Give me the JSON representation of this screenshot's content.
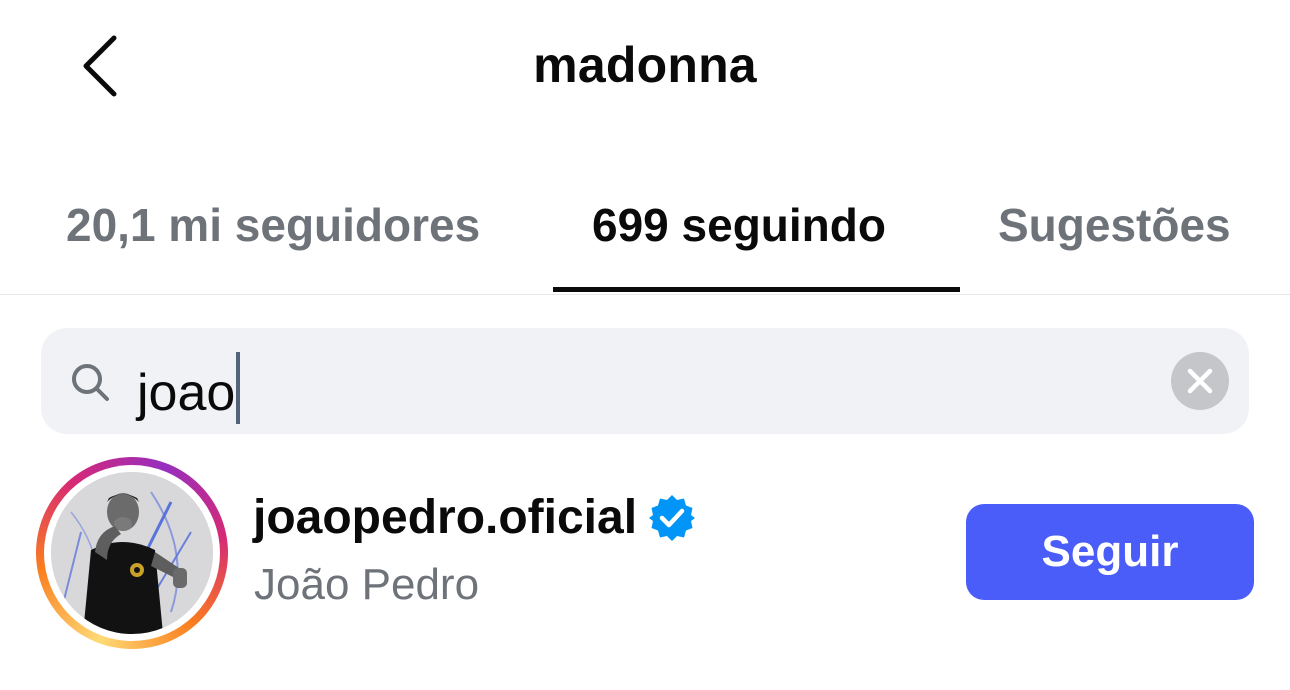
{
  "header": {
    "title": "madonna",
    "back_icon": "chevron-left-icon"
  },
  "tabs": [
    {
      "label": "20,1 mi seguidores",
      "active": false
    },
    {
      "label": "699 seguindo",
      "active": true
    },
    {
      "label": "Sugestões",
      "active": false
    }
  ],
  "search": {
    "value": "joao",
    "search_icon": "search-icon",
    "clear_icon": "clear-icon"
  },
  "results": [
    {
      "username": "joaopedro.oficial",
      "full_name": "João Pedro",
      "verified": true,
      "has_story_ring": true,
      "action_label": "Seguir"
    }
  ],
  "colors": {
    "primary_button": "#4a5df9",
    "verified_badge": "#0095f6",
    "inactive_text": "#6e737a",
    "active_text": "#0a0a0a"
  }
}
